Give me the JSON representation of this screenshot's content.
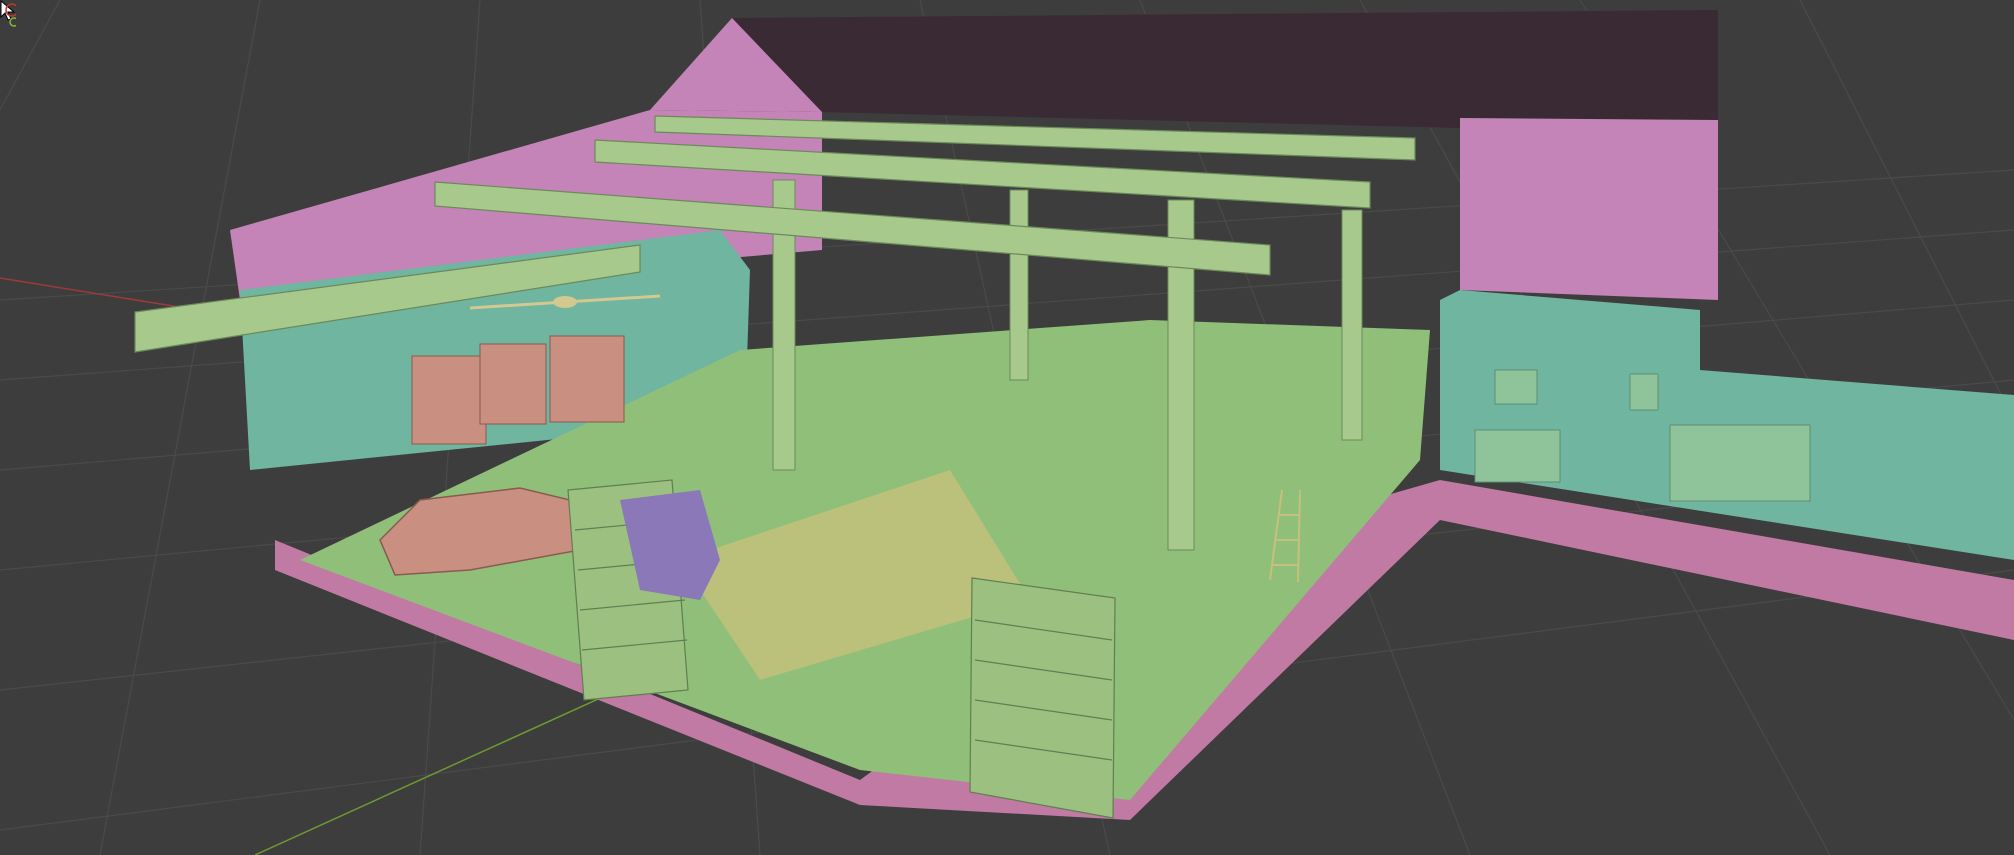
{
  "app": {
    "mode": "3d-viewport",
    "shading": "matcap-random-color"
  },
  "viewport": {
    "background_color": "#3d3d3d",
    "grid_color": "#4a4a4a",
    "x_axis_color": "#9c3b3b",
    "y_axis_color": "#6f9a2e"
  },
  "scene": {
    "building": {
      "roof_color": "#3a2a34",
      "wall_pink": "#c484b8",
      "wall_teal": "#6fb5a0",
      "floor_green": "#8fbf78",
      "beam_green": "#a8c98c",
      "props_copper": "#c98f80",
      "props_purple": "#8a78b8",
      "props_olive": "#c6c07c"
    },
    "objects": [
      {
        "name": "car",
        "color": "#c98f80"
      },
      {
        "name": "bookshelf-left",
        "color": "#9cc080"
      },
      {
        "name": "bookshelf-front",
        "color": "#9cc080"
      },
      {
        "name": "overhead-beams",
        "color": "#a8c98c"
      },
      {
        "name": "ceiling-fan",
        "color": "#d2c890"
      },
      {
        "name": "wall-shelves",
        "color": "#c98f80"
      },
      {
        "name": "support-columns",
        "color": "#a8c98c"
      },
      {
        "name": "ladder",
        "color": "#c6c07c"
      }
    ]
  },
  "overlay": {
    "cursor_icon": "arrow-cursor-icon",
    "gizmo_icon": "navigation-gizmo-icon"
  }
}
